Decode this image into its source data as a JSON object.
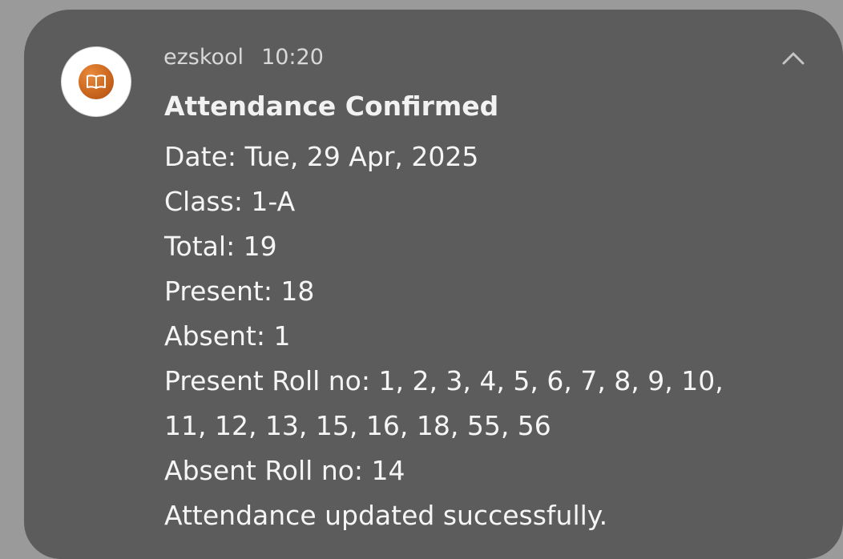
{
  "notification": {
    "app_name": "ezskool",
    "time": "10:20",
    "title": "Attendance Confirmed",
    "lines": [
      "Date: Tue, 29 Apr, 2025",
      "Class: 1-A",
      "Total: 19",
      "Present: 18",
      "Absent: 1",
      "Present Roll no: 1, 2, 3, 4, 5, 6, 7, 8, 9, 10,",
      "11, 12, 13, 15, 16, 18, 55, 56",
      "Absent Roll no: 14",
      "Attendance updated successfully."
    ],
    "icons": {
      "app": "open-book-icon",
      "collapse": "chevron-up-icon"
    }
  },
  "colors": {
    "background": "#9a9a9a",
    "card": "#5c5c5c",
    "app_icon": "#c8641c"
  }
}
